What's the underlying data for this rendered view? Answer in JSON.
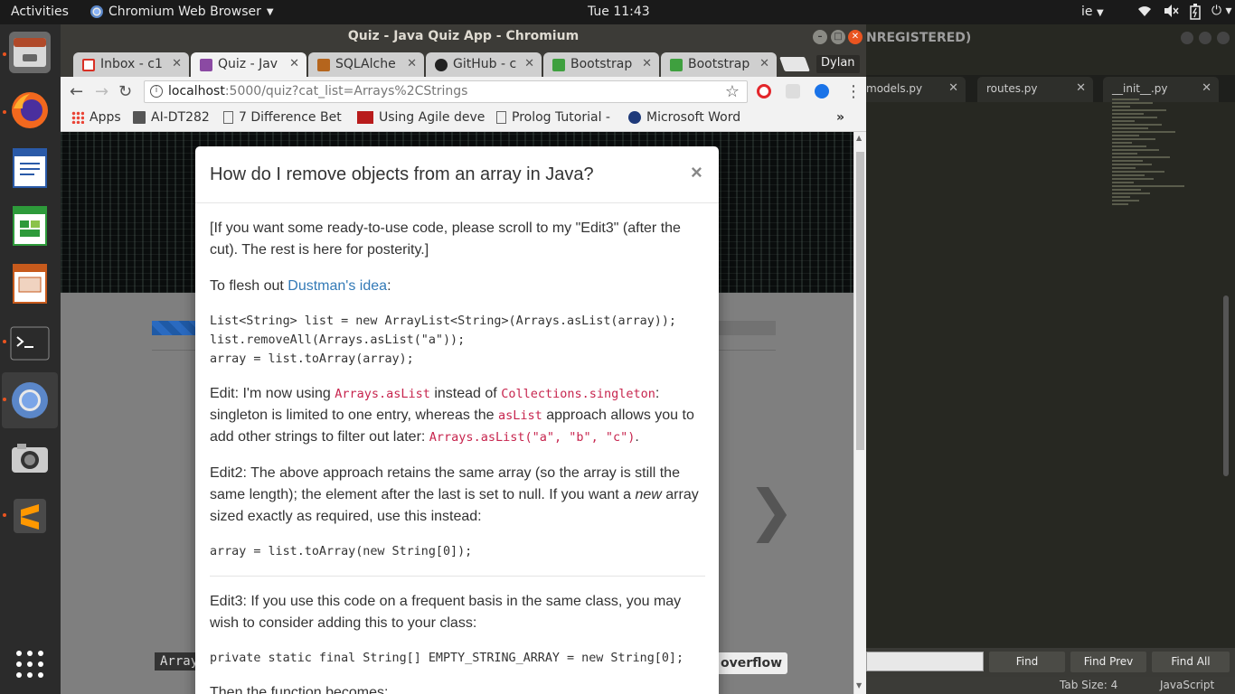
{
  "topbar": {
    "activities": "Activities",
    "app_menu": "Chromium Web Browser",
    "clock": "Tue 11:43",
    "lang": "ie"
  },
  "sublime": {
    "title": "NREGISTERED)",
    "tabs": [
      "models.py",
      "routes.py",
      "__init__.py"
    ],
    "find_buttons": [
      "Find",
      "Find Prev",
      "Find All"
    ],
    "status_tab_size": "Tab Size: 4",
    "status_syntax": "JavaScript"
  },
  "chrome": {
    "window_title": "Quiz - Java Quiz App - Chromium",
    "tabs": [
      {
        "label": "Inbox - c1",
        "color": "#d93025"
      },
      {
        "label": "Quiz - Jav",
        "color": "#8b4aa3"
      },
      {
        "label": "SQLAlche",
        "color": "#b5651d"
      },
      {
        "label": "GitHub - c",
        "color": "#222222"
      },
      {
        "label": "Bootstrap",
        "color": "#3fa03f"
      },
      {
        "label": "Bootstrap",
        "color": "#3fa03f"
      }
    ],
    "profile": "Dylan",
    "url_host": "localhost",
    "url_path": ":5000/quiz?cat_list=Arrays%2CStrings",
    "bookmarks": [
      {
        "label": "Apps"
      },
      {
        "label": "AI-DT282"
      },
      {
        "label": "7 Difference Bet"
      },
      {
        "label": "Using Agile deve"
      },
      {
        "label": "Prolog Tutorial -"
      },
      {
        "label": "Microsoft Word"
      }
    ],
    "bookmarks_overflow": "»"
  },
  "page": {
    "progress_fraction": 0.09,
    "bottom_left": "Array",
    "bottom_right": "overflow"
  },
  "modal": {
    "title": "How do I remove objects from an array in Java?",
    "close": "×",
    "p1": "[If you want some ready-to-use code, please scroll to my \"Edit3\" (after the cut). The rest is here for posterity.]",
    "p2_pre": "To flesh out ",
    "p2_link": "Dustman's idea",
    "p2_post": ":",
    "code1": "List<String> list = new ArrayList<String>(Arrays.asList(array));\nlist.removeAll(Arrays.asList(\"a\"));\narray = list.toArray(array);",
    "edit1_a": "Edit: I'm now using ",
    "edit1_code1": "Arrays.asList",
    "edit1_b": " instead of ",
    "edit1_code2": "Collections.singleton",
    "edit1_c": ": singleton is limited to one entry, whereas the ",
    "edit1_code3": "asList",
    "edit1_d": " approach allows you to add other strings to filter out later: ",
    "edit1_code4": "Arrays.asList(\"a\", \"b\", \"c\")",
    "edit1_e": ".",
    "edit2_a": "Edit2: The above approach retains the same array (so the array is still the same length); the element after the last is set to null. If you want a ",
    "edit2_em": "new",
    "edit2_b": " array sized exactly as required, use this instead:",
    "code2": "array = list.toArray(new String[0]);",
    "edit3": "Edit3: If you use this code on a frequent basis in the same class, you may wish to consider adding this to your class:",
    "code3": "private static final String[] EMPTY_STRING_ARRAY = new String[0];",
    "then": "Then the function becomes:"
  }
}
